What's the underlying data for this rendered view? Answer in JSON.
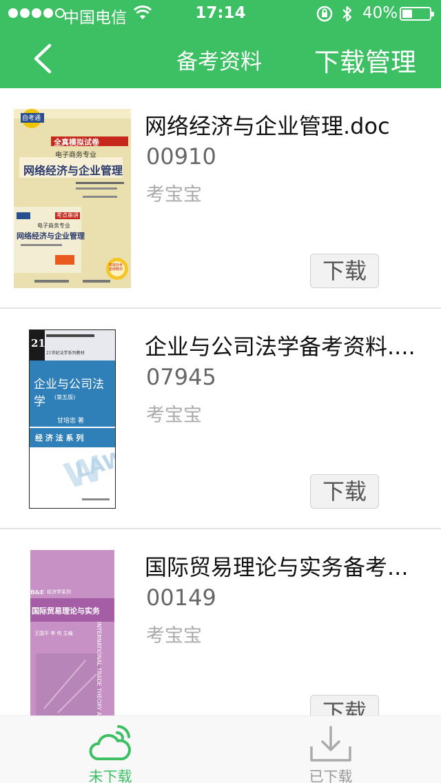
{
  "status_bar": {
    "carrier": "中国电信",
    "time": "17:14",
    "battery": "40%"
  },
  "nav": {
    "title": "备考资料",
    "right_label": "下载管理"
  },
  "items": [
    {
      "title": "网络经济与企业管理.doc",
      "code": "00910",
      "source": "考宝宝",
      "download_label": "下载",
      "cover": {
        "bg_color": "#eadfae",
        "accent_color": "#c7281c",
        "brand": "自考通",
        "subtitle": "电子商务专业",
        "title": "网络经济与企业管理",
        "badge": "全真模拟试卷",
        "sub_title": "网络经济与企业管理",
        "sub_badge": "考点串讲",
        "sub_subtitle": "电子商务专业",
        "sticker": "权威自考金牌教材"
      }
    },
    {
      "title": "企业与公司法学备考资料....",
      "code": "07945",
      "source": "考宝宝",
      "download_label": "下载",
      "cover": {
        "bg_color": "#2f7fb8",
        "header_color": "#e8e8ef",
        "series_mark": "21",
        "series": "21世纪法学系列教材",
        "title": "企业与公司法学",
        "edition": "(第五版)",
        "author": "甘培忠 著",
        "subseries": "经 济 法 系 列",
        "watermark": "LAW"
      }
    },
    {
      "title": "国际贸易理论与实务备考...",
      "code": "00149",
      "source": "考宝宝",
      "download_label": "下载",
      "cover": {
        "bg_color": "#c791c5",
        "band_color": "#a55da6",
        "brand": "B&E",
        "series": "经济学系列",
        "title": "国际贸易理论与实务",
        "authors": "王国平 李 伟 主编",
        "vertical_text": "INTERNATIONAL TRADE THEORY AND PRACTICE"
      }
    }
  ],
  "tabbar": {
    "tabs": [
      {
        "label": "未下载",
        "icon": "cloud-signal-icon",
        "active": true
      },
      {
        "label": "已下载",
        "icon": "tray-download-icon",
        "active": false
      }
    ]
  },
  "colors": {
    "primary": "#3dbf64",
    "divider": "#e2e2e2",
    "inactive": "#999999"
  }
}
